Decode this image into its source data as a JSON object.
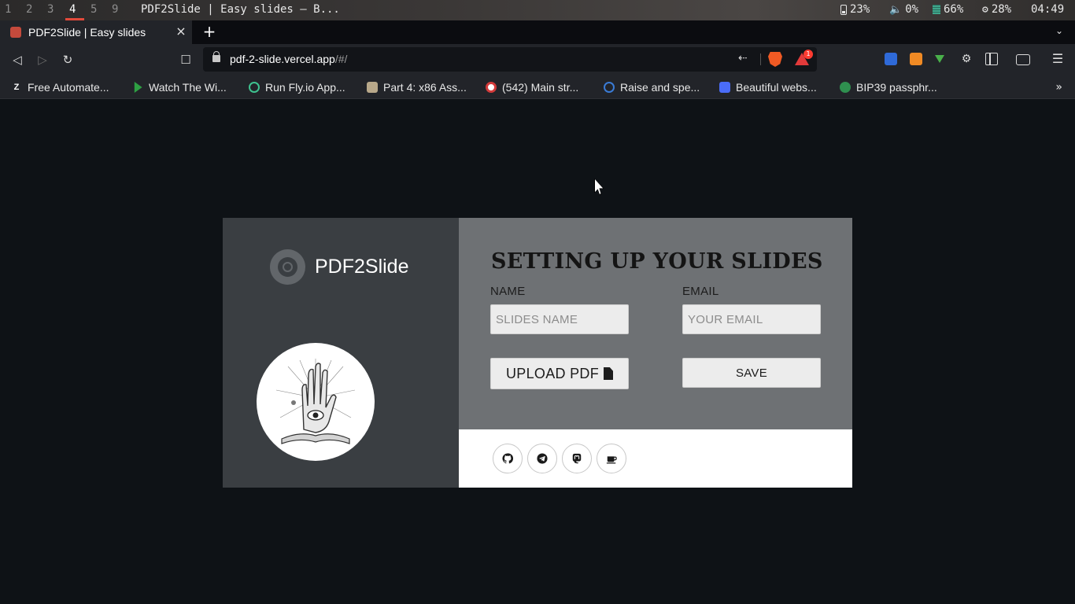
{
  "system_bar": {
    "workspaces": [
      "1",
      "2",
      "3",
      "4",
      "5",
      "9"
    ],
    "active_workspace": "4",
    "window_title": "PDF2Slide | Easy slides — B...",
    "battery": "23%",
    "volume": "0%",
    "memory": "66%",
    "cpu": "28%",
    "clock": "04:49"
  },
  "browser": {
    "tab_title": "PDF2Slide | Easy slides",
    "url_host": "pdf-2-slide.vercel.app",
    "url_path": "/#/",
    "rewards_badge": "1",
    "bookmarks": [
      {
        "label": "Free Automate...",
        "icon": "z-letter-icon",
        "glyph": "Z",
        "color": "#222429"
      },
      {
        "label": "Watch The Wi...",
        "icon": "play-icon",
        "glyph": "",
        "color": "#2ea043"
      },
      {
        "label": "Run Fly.io App...",
        "icon": "spiral-icon",
        "glyph": "",
        "color": "#3ec28f"
      },
      {
        "label": "Part 4: x86 Ass...",
        "icon": "book-icon",
        "glyph": "",
        "color": "#b8a88a"
      },
      {
        "label": "(542) Main str...",
        "icon": "badge-icon",
        "glyph": "",
        "color": "#d23a3a"
      },
      {
        "label": "Raise and spe...",
        "icon": "c-logo-icon",
        "glyph": "",
        "color": "#3a7bd5"
      },
      {
        "label": "Beautiful webs...",
        "icon": "f-logo-icon",
        "glyph": "",
        "color": "#4a6cf7"
      },
      {
        "label": "BIP39 passphr...",
        "icon": "gear-icon",
        "glyph": "",
        "color": "#2f8f4f"
      }
    ]
  },
  "app": {
    "brand_name": "PDF2Slide",
    "form_title": "SETTING UP YOUR SLIDES",
    "name_label": "NAME",
    "name_placeholder": "SLIDES NAME",
    "email_label": "EMAIL",
    "email_placeholder": "YOUR EMAIL",
    "upload_label": "UPLOAD PDF",
    "save_label": "SAVE",
    "social": [
      {
        "name": "github-icon"
      },
      {
        "name": "telegram-icon"
      },
      {
        "name": "mastodon-icon"
      },
      {
        "name": "coffee-icon"
      }
    ]
  },
  "colors": {
    "page_bg": "#0e1216",
    "left_panel": "#3a3e42",
    "right_panel": "#6e7174",
    "social_bar": "#ffffff"
  }
}
